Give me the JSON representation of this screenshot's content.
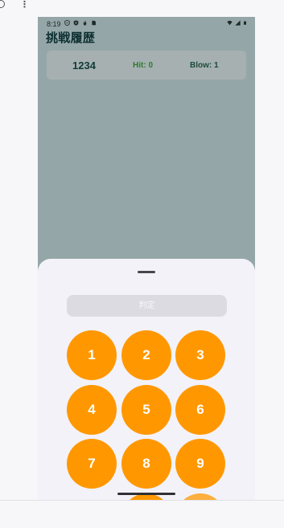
{
  "host": {
    "clock_icon": "clock-icon",
    "more_icon": "more-vertical-icon",
    "more_glyph": "⋮"
  },
  "status_bar": {
    "time": "8:19",
    "left_icons": [
      "shield-icon",
      "vpn-icon",
      "fire-icon",
      "sim-icon"
    ],
    "right_icons": [
      "wifi-icon",
      "signal-icon",
      "battery-icon"
    ]
  },
  "app": {
    "title": "挑戦履歴"
  },
  "history": [
    {
      "guess": "1234",
      "hit": "Hit: 0",
      "blow": "Blow: 1"
    }
  ],
  "sheet": {
    "judge_label": "判定",
    "keys": [
      "1",
      "2",
      "3",
      "4",
      "5",
      "6",
      "7",
      "8",
      "9"
    ]
  },
  "colors": {
    "accent": "#ff9800",
    "app_background": "#95a6a8",
    "sheet_background": "#f3f2f8",
    "title": "#0c2f2f",
    "hit": "#2f7a2d"
  }
}
